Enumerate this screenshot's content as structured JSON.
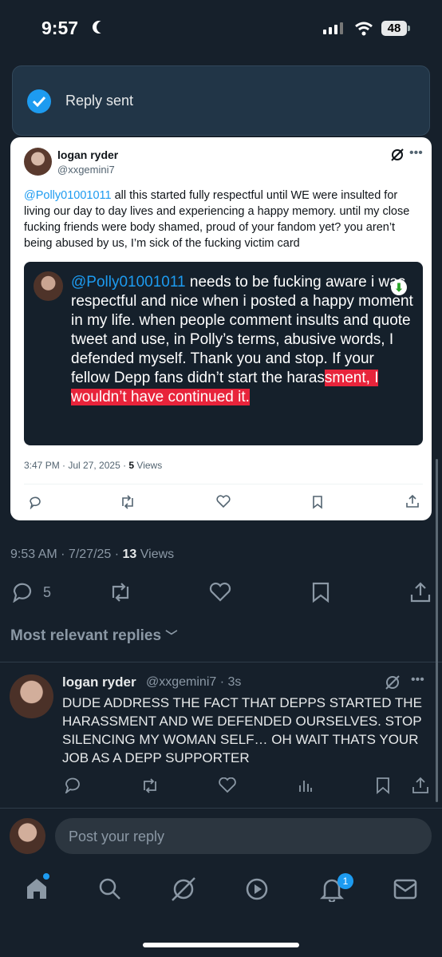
{
  "status_bar": {
    "time": "9:57",
    "battery": "48"
  },
  "toast": {
    "text": "Reply sent"
  },
  "quoted": {
    "name": "logan ryder",
    "handle": "@xxgemini7",
    "mention": "@Polly01001011",
    "body": " all this started fully respectful until WE were insulted for living our day to day lives and experiencing a happy memory. until my close fucking friends were body shamed, proud of your fandom yet? you aren’t being abused by us, I’m sick of the fucking victim card",
    "image_mention": "@Polly01001011",
    "image_text": " needs to be fucking aware i was respectful and nice when i posted a happy moment in my life. when people comment insults and quote tweet and use, in Polly’s terms, abusive words, I defended myself. Thank you and stop. If your fellow Depp fans didn’t start the haras",
    "image_highlight": "sment, I wouldn’t have continued it.",
    "time": "3:47 PM · Jul 27, 2025 · ",
    "views_count": "5",
    "views_label": " Views"
  },
  "post_meta": {
    "time": "9:53 AM · 7/27/25 · ",
    "views_count": "13",
    "views_label": " Views"
  },
  "actions": {
    "reply_count": "5"
  },
  "replies_sort": "Most relevant replies",
  "reply": {
    "name": "logan ryder",
    "handle": "@xxgemini7 · 3s",
    "text": "DUDE ADDRESS THE FACT THAT DEPPS STARTED THE HARASSMENT AND WE DEFENDED OURSELVES. STOP SILENCING MY WOMAN SELF… OH WAIT THATS YOUR JOB AS A DEPP SUPPORTER"
  },
  "compose": {
    "placeholder": "Post your reply"
  },
  "nav": {
    "notifications_badge": "1"
  }
}
